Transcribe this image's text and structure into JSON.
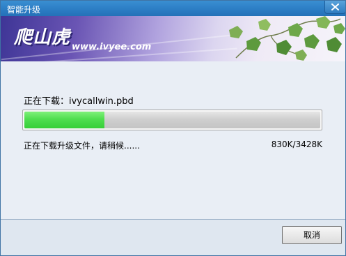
{
  "window": {
    "title": "智能升级"
  },
  "banner": {
    "logo_text": "爬山虎",
    "site_url": "www.ivyee.com"
  },
  "download": {
    "file_label": "正在下载：ivycallwin.pbd",
    "status_text": "正在下载升级文件，请稍候......",
    "size_text": "830K/3428K",
    "progress_fraction": 0.27
  },
  "buttons": {
    "cancel_label": "取消"
  },
  "icons": {
    "close": "close-icon",
    "vine": "ivy-vine-decoration"
  },
  "colors": {
    "titlebar": "#2d7fc6",
    "progress_fill": "#4fde4f",
    "banner_dark": "#3e3596"
  }
}
